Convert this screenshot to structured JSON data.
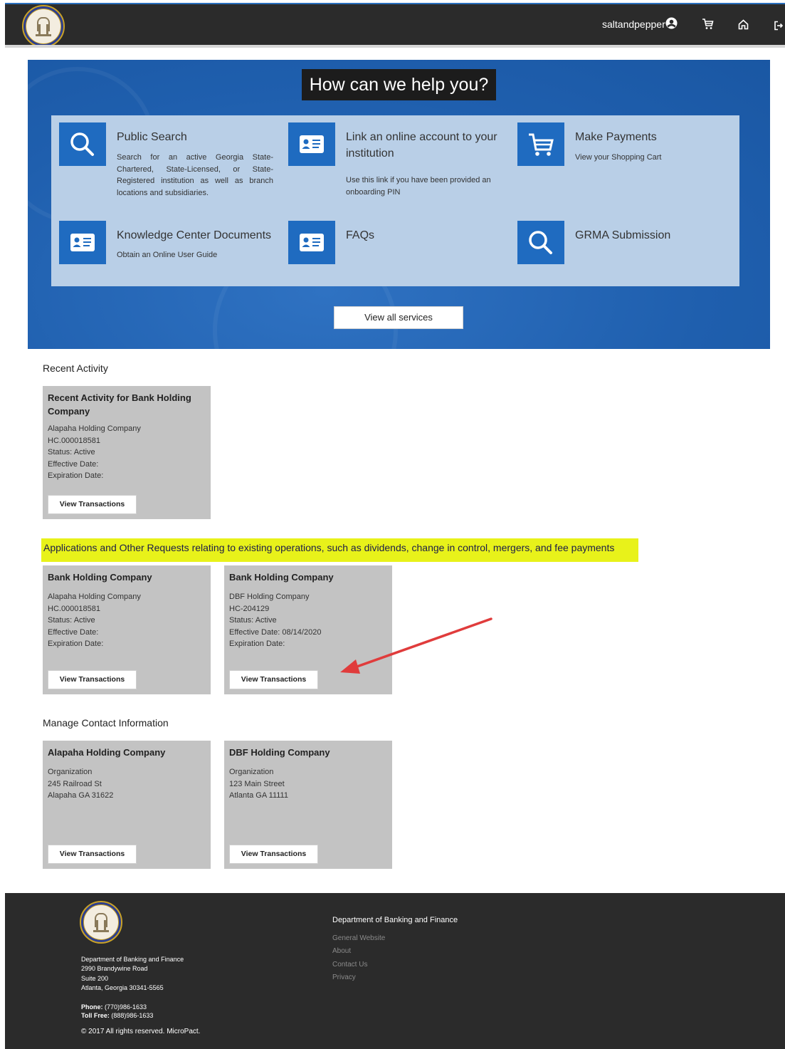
{
  "header": {
    "username": "saltandpepper",
    "icons": [
      "user-circle-icon",
      "cart-icon",
      "home-icon",
      "sign-out-icon"
    ]
  },
  "hero": {
    "title": "How can we help you?",
    "services": [
      {
        "title": "Public Search",
        "description": "Search for an active Georgia State-Chartered, State-Licensed, or State-Registered institution as well as branch locations and subsidiaries.",
        "icon": "search-icon"
      },
      {
        "title": "Link an online account to your institution",
        "description": "Use this link if you have been provided an onboarding PIN",
        "icon": "id-card-icon"
      },
      {
        "title": "Make Payments",
        "description": "View your Shopping Cart",
        "icon": "cart-icon"
      },
      {
        "title": "Knowledge Center Documents",
        "description": "Obtain an Online User Guide",
        "icon": "id-card-icon"
      },
      {
        "title": "FAQs",
        "description": "",
        "icon": "id-card-icon"
      },
      {
        "title": "GRMA Submission",
        "description": "",
        "icon": "search-icon"
      }
    ],
    "view_all_label": "View all services"
  },
  "recent_activity": {
    "title": "Recent Activity",
    "card": {
      "title": "Recent Activity for Bank Holding Company",
      "lines": [
        "Alapaha Holding Company",
        "HC.000018581",
        "Status: Active",
        "Effective Date:",
        "Expiration Date:"
      ],
      "button": "View Transactions"
    }
  },
  "applications": {
    "title": "Applications and Other Requests relating to existing operations, such as dividends, change in control, mergers, and fee payments",
    "cards": [
      {
        "title": "Bank Holding Company",
        "lines": [
          "Alapaha Holding Company",
          "HC.000018581",
          "Status: Active",
          "Effective Date:",
          "Expiration Date:"
        ],
        "button": "View Transactions"
      },
      {
        "title": "Bank Holding Company",
        "lines": [
          "DBF Holding Company",
          "HC-204129",
          "Status: Active",
          "Effective Date: 08/14/2020",
          "Expiration Date:"
        ],
        "button": "View Transactions"
      }
    ]
  },
  "contacts": {
    "title": "Manage Contact Information",
    "cards": [
      {
        "title": "Alapaha Holding Company",
        "lines": [
          "Organization",
          "245 Railroad St",
          "Alapaha GA 31622"
        ],
        "button": "View Transactions"
      },
      {
        "title": "DBF Holding Company",
        "lines": [
          "Organization",
          "123 Main Street",
          "Atlanta GA 11111"
        ],
        "button": "View Transactions"
      }
    ]
  },
  "footer": {
    "address": [
      "Department of Banking and Finance",
      "2990 Brandywine Road",
      "Suite 200",
      "Atlanta, Georgia 30341-5565"
    ],
    "phone_label": "Phone:",
    "phone": "(770)986-1633",
    "tollfree_label": "Toll Free:",
    "tollfree": "(888)986-1633",
    "copyright": "© 2017 All rights reserved. MicroPact.",
    "links_title": "Department of Banking and Finance",
    "links": [
      "General Website",
      "About",
      "Contact Us",
      "Privacy"
    ]
  },
  "colors": {
    "header_bg": "#2b2b2b",
    "hero_blue": "#1f5fae",
    "panel_blue": "#b9cfe7",
    "icon_blue": "#1f6bc0",
    "highlight": "#e8f21a",
    "card_gray": "#c3c3c3",
    "arrow_red": "#e03c3c"
  }
}
